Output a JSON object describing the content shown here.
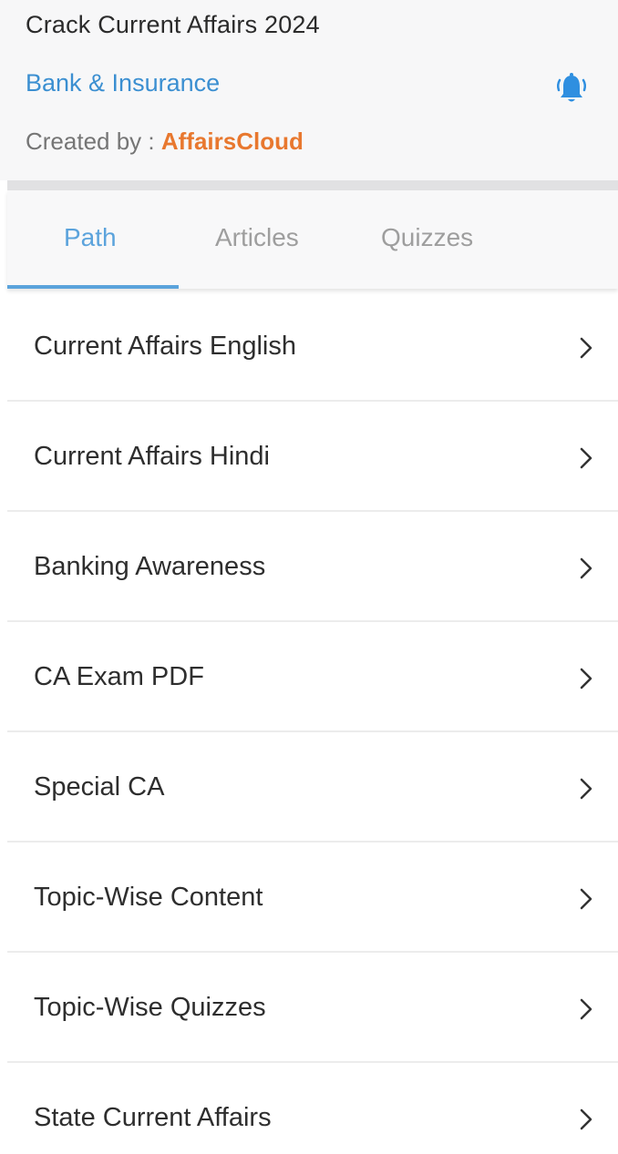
{
  "header": {
    "title": "Crack Current Affairs 2024",
    "category": "Bank & Insurance",
    "created_by_label": "Created by : ",
    "creator": "AffairsCloud",
    "bell_icon": "notification-bell-icon"
  },
  "tabs": [
    {
      "label": "Path",
      "active": true
    },
    {
      "label": "Articles",
      "active": false
    },
    {
      "label": "Quizzes",
      "active": false
    }
  ],
  "items": [
    {
      "label": "Current Affairs English"
    },
    {
      "label": "Current Affairs Hindi"
    },
    {
      "label": "Banking Awareness"
    },
    {
      "label": "CA Exam PDF"
    },
    {
      "label": "Special CA"
    },
    {
      "label": "Topic-Wise Content"
    },
    {
      "label": "Topic-Wise Quizzes"
    },
    {
      "label": "State Current Affairs"
    }
  ],
  "colors": {
    "accent": "#5ba3dc",
    "category": "#3b8fd1",
    "creator": "#e8782f"
  }
}
